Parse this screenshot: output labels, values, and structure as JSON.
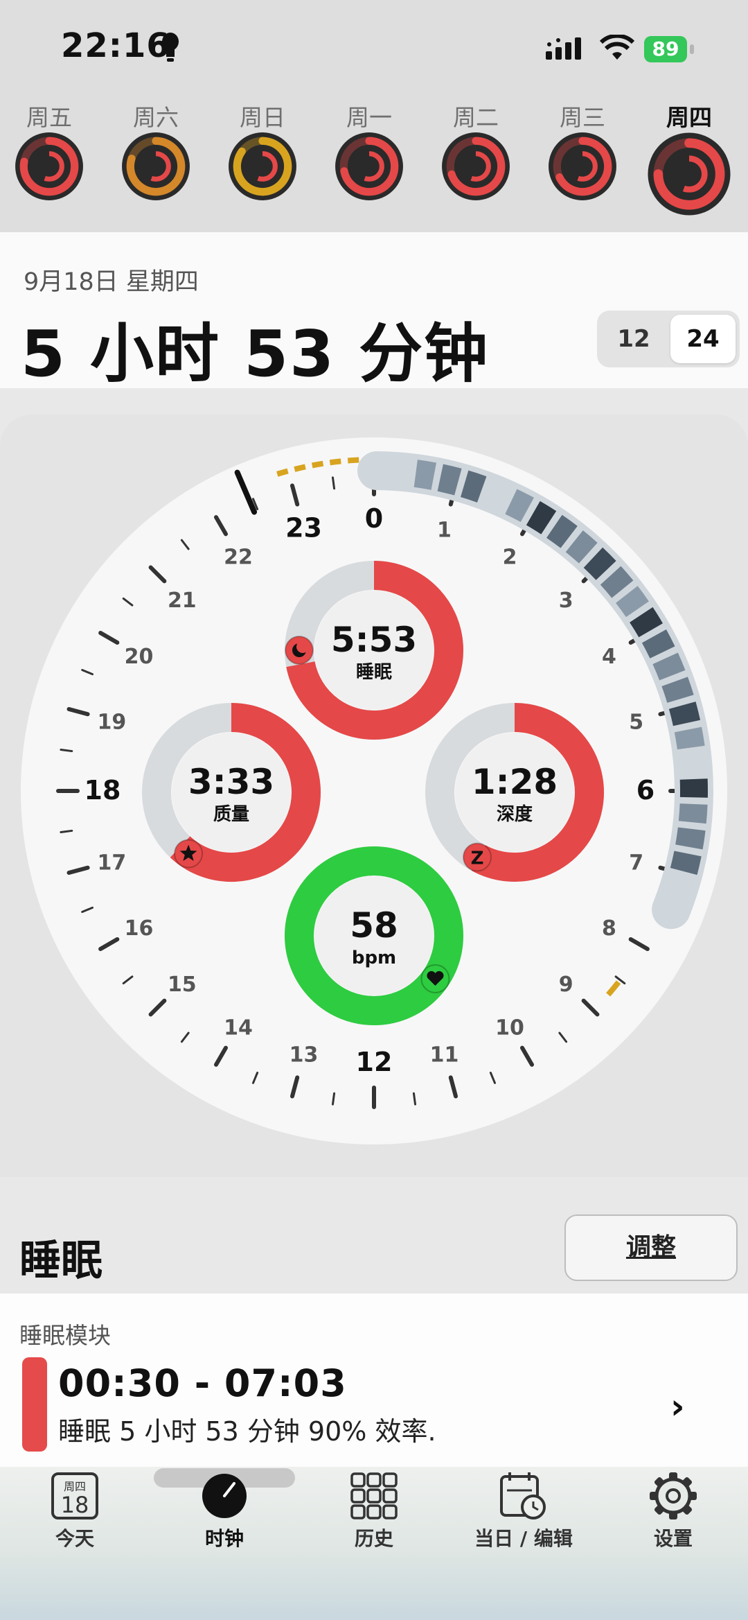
{
  "status_bar": {
    "time": "22:16",
    "battery": "89"
  },
  "week": {
    "days": [
      {
        "label": "周五",
        "color": "#e54848",
        "fill": 0.78,
        "bg": "#2a2a2a"
      },
      {
        "label": "周六",
        "color": "#d4882a",
        "fill": 0.8,
        "bg": "#2a2a2a"
      },
      {
        "label": "周日",
        "color": "#d8a420",
        "fill": 0.85,
        "bg": "#2a2a2a"
      },
      {
        "label": "周一",
        "color": "#e54848",
        "fill": 0.72,
        "bg": "#2a2a2a"
      },
      {
        "label": "周二",
        "color": "#e54848",
        "fill": 0.7,
        "bg": "#2a2a2a"
      },
      {
        "label": "周三",
        "color": "#e54848",
        "fill": 0.68,
        "bg": "#2a2a2a"
      },
      {
        "label": "周四",
        "color": "#e54848",
        "fill": 0.75,
        "bg": "#2a2a2a"
      }
    ],
    "active_index": 6
  },
  "header": {
    "date": "9月18日 星期四",
    "duration": "5 小时 53 分钟",
    "toggle": [
      "12",
      "24"
    ],
    "toggle_selected": "24"
  },
  "clock": {
    "hour_labels": [
      "0",
      "1",
      "2",
      "3",
      "4",
      "5",
      "6",
      "7",
      "8",
      "9",
      "10",
      "11",
      "12",
      "13",
      "14",
      "15",
      "16",
      "17",
      "18",
      "19",
      "20",
      "21",
      "22",
      "23"
    ],
    "metrics": {
      "sleep": {
        "value": "5:53",
        "label": "睡眠",
        "fraction": 0.72,
        "color": "#e54848",
        "icon": "moon-icon"
      },
      "quality": {
        "value": "3:33",
        "label": "质量",
        "fraction": 0.62,
        "color": "#e54848",
        "icon": "star-icon"
      },
      "deep": {
        "value": "1:28",
        "label": "深度",
        "fraction": 0.58,
        "color": "#e54848",
        "icon": "z-icon"
      },
      "heart": {
        "value": "58",
        "label": "bpm",
        "fraction": 1.0,
        "color": "#2ecc40",
        "icon": "heart-icon"
      }
    }
  },
  "sleep": {
    "title": "睡眠",
    "adjust": "调整",
    "module_label": "睡眠模块",
    "range": "00:30 - 07:03",
    "description": "睡眠 5 小时 53 分钟 90% 效率."
  },
  "tabbar": {
    "tabs": [
      {
        "label": "今天",
        "icon": "calendar-day-icon",
        "day_top": "周四",
        "day_num": "18"
      },
      {
        "label": "时钟",
        "icon": "clock-icon"
      },
      {
        "label": "历史",
        "icon": "grid-icon"
      },
      {
        "label": "当日 / 编辑",
        "icon": "calendar-clock-icon"
      },
      {
        "label": "设置",
        "icon": "gear-icon"
      }
    ],
    "active_index": 1
  }
}
